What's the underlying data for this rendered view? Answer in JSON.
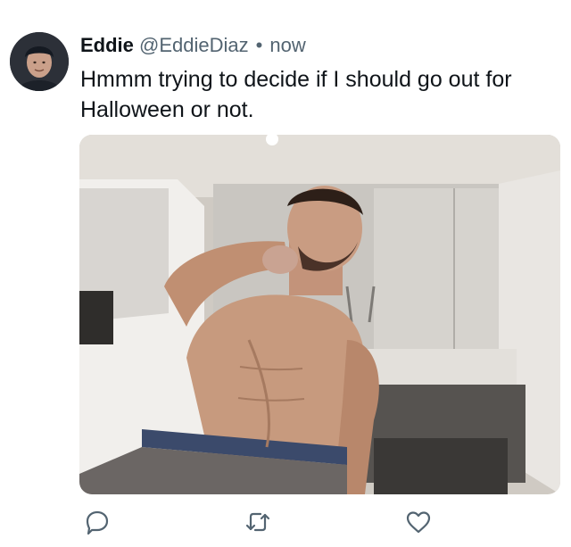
{
  "tweet": {
    "author_name": "Eddie",
    "author_handle": "@EddieDiaz",
    "separator": "•",
    "timestamp": "now",
    "text": "Hmmm trying to decide if I should go out for Halloween or not."
  },
  "icons": {
    "reply": "reply-icon",
    "retweet": "retweet-icon",
    "like": "heart-icon"
  },
  "colors": {
    "primary_text": "#0f1419",
    "secondary_text": "#536471",
    "icon": "#536471"
  }
}
